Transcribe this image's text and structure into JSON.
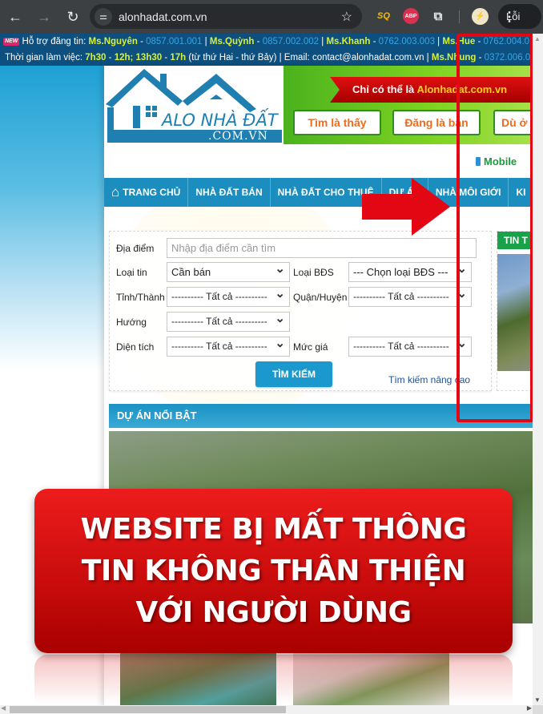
{
  "browser": {
    "url": "alonhadat.com.vn",
    "profile_label": "Lỗi",
    "icons": {
      "back": "back-arrow-icon",
      "forward": "forward-arrow-icon",
      "reload": "reload-icon",
      "site_info": "tune-icon",
      "bookmark": "star-icon",
      "ext1": "SQ",
      "ext2": "ABP",
      "extensions": "puzzle-icon",
      "menu": "kebab-menu-icon"
    }
  },
  "topbar": {
    "new_badge": "NEW",
    "support_label": "Hỗ trợ đăng tin:",
    "contacts": [
      {
        "name": "Ms.Nguyên",
        "phone": "0857.001.001"
      },
      {
        "name": "Ms.Quỳnh",
        "phone": "0857.002.002"
      },
      {
        "name": "Ms.Khanh",
        "phone": "0762.003.003"
      },
      {
        "name": "Ms.Hue",
        "phone": "0762.004.0"
      }
    ],
    "hours_label": "Thời gian làm việc:",
    "hours_a": "7h30",
    "hours_b": "12h; 13h30",
    "hours_c": "17h",
    "hours_days": "(từ thứ Hai - thứ Bảy) | Email: contact@alonhadat.com.vn |",
    "extra_contact": {
      "name": "Ms.Nhung",
      "phone": "0372.006.0"
    }
  },
  "header": {
    "logo_text": "ALO NHÀ ĐẤT",
    "logo_domain": ".COM.VN",
    "banner_prefix": "Chỉ có thể là",
    "banner_brand": "Alonhadat.com.vn",
    "banner_chips": [
      "Tìm là thấy",
      "Đăng là bán",
      "Dù ở"
    ],
    "mobile_link": "Mobile"
  },
  "menu": {
    "items": [
      "TRANG CHỦ",
      "NHÀ ĐẤT BÁN",
      "NHÀ ĐẤT CHO THUÊ",
      "DỰ ÁN",
      "NHÀ MÔI GIỚI",
      "KI"
    ]
  },
  "search": {
    "location_label": "Địa điểm",
    "location_placeholder": "Nhập địa điểm cần tìm",
    "type_label": "Loại tin",
    "type_value": "Cần bán",
    "property_label": "Loại BĐS",
    "property_value": "--- Chọn loại BĐS ---",
    "province_label": "Tỉnh/Thành",
    "province_value": "---------- Tất cả ----------",
    "district_label": "Quận/Huyện",
    "district_value": "---------- Tất cả ----------",
    "direction_label": "Hướng",
    "direction_value": "---------- Tất cả ----------",
    "area_label": "Diện tích",
    "area_value": "---------- Tất cả ----------",
    "price_label": "Mức giá",
    "price_value": "---------- Tất cả ----------",
    "submit_label": "TÌM KIẾM",
    "advanced_link": "Tìm kiếm nâng cao"
  },
  "news": {
    "heading": "TIN T"
  },
  "projects": {
    "heading": "DỰ ÁN NỔI BẬT"
  },
  "annotation": {
    "lines": [
      "WEBSITE BỊ MẤT THÔNG",
      "TIN KHÔNG THÂN THIỆN",
      "VỚI NGƯỜI DÙNG"
    ],
    "highlight_color": "#e30613"
  },
  "colors": {
    "topbar": "#0d4f7e",
    "menu": "#1b8ebf",
    "accent_green": "#19a24a",
    "callout_red": "#d40f0f"
  }
}
